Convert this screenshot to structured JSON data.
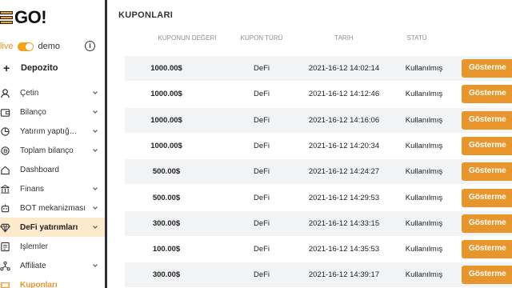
{
  "brand": {
    "logo_text": "GO!"
  },
  "mode": {
    "live_label": "live",
    "demo_label": "demo"
  },
  "deposit_label": "Depozito",
  "nav": [
    {
      "label": "Çetin",
      "icon": "user-icon",
      "chevron": true,
      "active": false,
      "sub": false
    },
    {
      "label": "Bilanço",
      "icon": "wallet-icon",
      "chevron": true,
      "active": false,
      "sub": false
    },
    {
      "label": "Yatırım yaptığ…",
      "icon": "chart-pie-icon",
      "chevron": true,
      "active": false,
      "sub": false
    },
    {
      "label": "Toplam bilanço",
      "icon": "coin-icon",
      "chevron": true,
      "active": false,
      "sub": false
    },
    {
      "label": "Dashboard",
      "icon": "home-icon",
      "chevron": false,
      "active": false,
      "sub": false
    },
    {
      "label": "Finans",
      "icon": "bank-icon",
      "chevron": true,
      "active": false,
      "sub": false
    },
    {
      "label": "BOT mekanizması",
      "icon": "bot-icon",
      "chevron": true,
      "active": false,
      "sub": false
    },
    {
      "label": "DeFi yatırımları",
      "icon": "diamond-icon",
      "chevron": true,
      "active": true,
      "sub": false
    },
    {
      "label": "İşlemler",
      "icon": "list-icon",
      "chevron": false,
      "active": false,
      "sub": false
    },
    {
      "label": "Affiliate",
      "icon": "network-icon",
      "chevron": true,
      "active": false,
      "sub": false
    },
    {
      "label": "Kuponları",
      "icon": "ticket-icon",
      "chevron": false,
      "active": false,
      "sub": true
    }
  ],
  "page": {
    "title": "KUPONLARI",
    "columns": [
      "KUPONUN DEĞERI",
      "KUPON TÜRÜ",
      "TARIH",
      "STATÜ"
    ],
    "button_label": "Gösterme",
    "rows": [
      {
        "value": "1000.00$",
        "type": "DeFi",
        "date": "2021-16-12 14:02:14",
        "status": "Kullanılmış"
      },
      {
        "value": "1000.00$",
        "type": "DeFi",
        "date": "2021-16-12 14:12:46",
        "status": "Kullanılmış"
      },
      {
        "value": "1000.00$",
        "type": "DeFi",
        "date": "2021-16-12 14:16:06",
        "status": "Kullanılmış"
      },
      {
        "value": "1000.00$",
        "type": "DeFi",
        "date": "2021-16-12 14:20:34",
        "status": "Kullanılmış"
      },
      {
        "value": "500.00$",
        "type": "DeFi",
        "date": "2021-16-12 14:24:27",
        "status": "Kullanılmış"
      },
      {
        "value": "500.00$",
        "type": "DeFi",
        "date": "2021-16-12 14:29:53",
        "status": "Kullanılmış"
      },
      {
        "value": "300.00$",
        "type": "DeFi",
        "date": "2021-16-12 14:33:15",
        "status": "Kullanılmış"
      },
      {
        "value": "100.00$",
        "type": "DeFi",
        "date": "2021-16-12 14:35:53",
        "status": "Kullanılmış"
      },
      {
        "value": "300.00$",
        "type": "DeFi",
        "date": "2021-16-12 14:39:17",
        "status": "Kullanılmış"
      }
    ]
  },
  "colors": {
    "accent": "#e8952d",
    "active_bg": "#fde9cc",
    "row_shade": "#f2f3f5",
    "divider": "#2b2f3a"
  }
}
